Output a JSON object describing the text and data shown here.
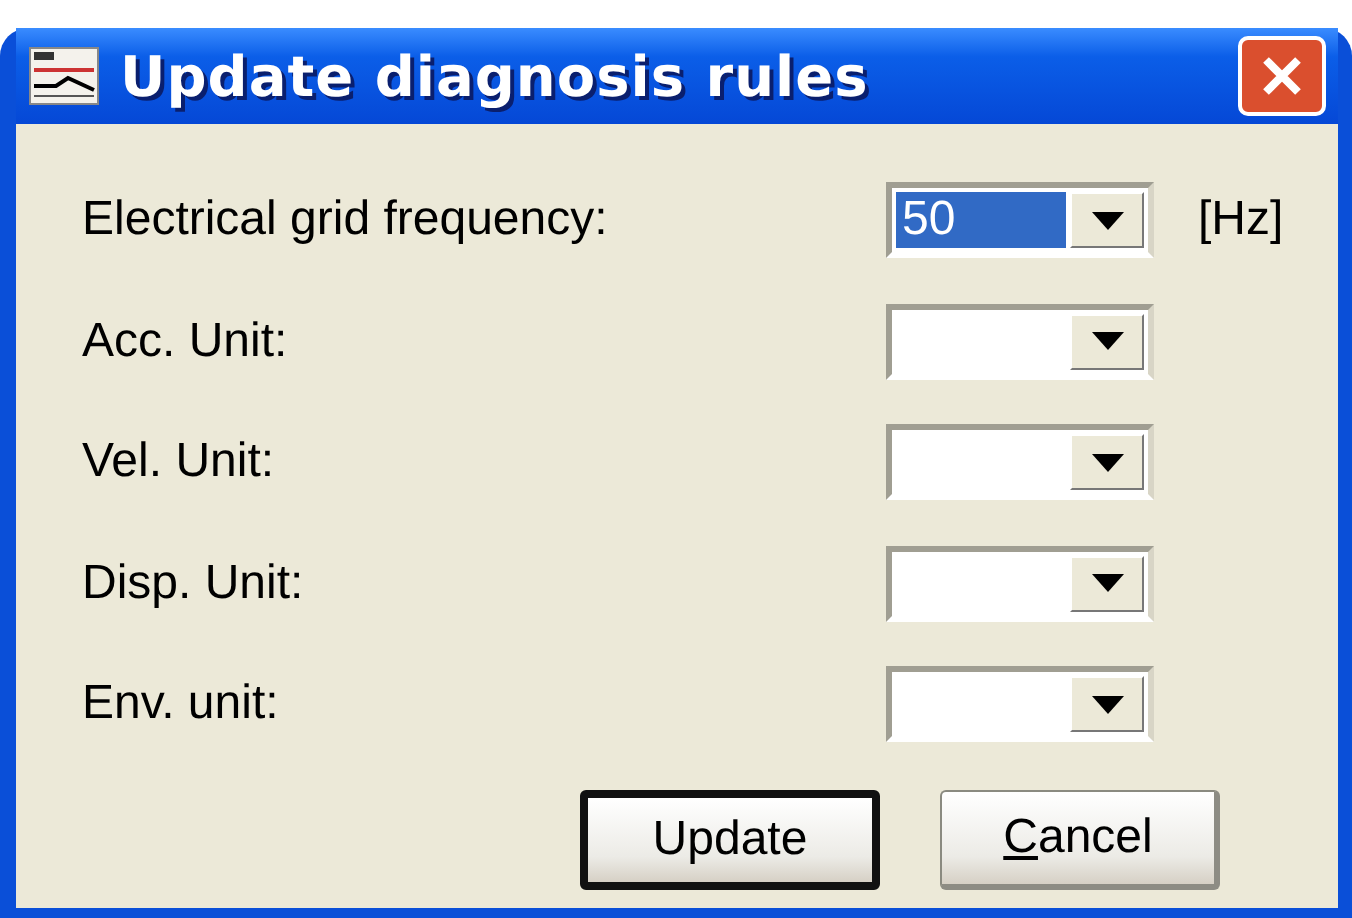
{
  "window": {
    "title": "Update diagnosis rules"
  },
  "fields": [
    {
      "label": "Electrical grid frequency:",
      "value": "50",
      "focused": true,
      "unit": "[Hz]"
    },
    {
      "label": "Acc. Unit:",
      "focused": false
    },
    {
      "label": "Vel. Unit:",
      "focused": false
    },
    {
      "label": "Disp. Unit:",
      "focused": false
    },
    {
      "label": "Env. unit:",
      "focused": false
    }
  ],
  "buttons": [
    {
      "label": "Update",
      "default": true,
      "underline_first": false
    },
    {
      "label": "Cancel",
      "default": false,
      "underline_first": true
    }
  ]
}
